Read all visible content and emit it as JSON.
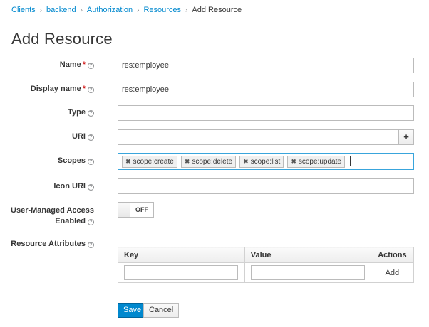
{
  "breadcrumb": {
    "items": [
      "Clients",
      "backend",
      "Authorization",
      "Resources"
    ],
    "current": "Add Resource"
  },
  "page_title": "Add Resource",
  "form": {
    "name": {
      "label": "Name",
      "required": "*",
      "value": "res:employee"
    },
    "display_name": {
      "label": "Display name",
      "required": "*",
      "value": "res:employee"
    },
    "type": {
      "label": "Type",
      "value": ""
    },
    "uri": {
      "label": "URI",
      "value": "",
      "add_label": "+"
    },
    "scopes": {
      "label": "Scopes",
      "items": [
        "scope:create",
        "scope:delete",
        "scope:list",
        "scope:update"
      ]
    },
    "icon_uri": {
      "label": "Icon URI",
      "value": ""
    },
    "user_managed": {
      "label_line1": "User-Managed Access",
      "label_line2": "Enabled",
      "toggle_state": "OFF"
    },
    "resource_attributes": {
      "label": "Resource Attributes",
      "columns": [
        "Key",
        "Value",
        "Actions"
      ],
      "add_label": "Add"
    }
  },
  "buttons": {
    "save": "Save",
    "cancel": "Cancel"
  },
  "colors": {
    "link": "#0088ce",
    "primary": "#0088ce",
    "required": "#cc0000",
    "focus_border": "#39a5dc"
  }
}
